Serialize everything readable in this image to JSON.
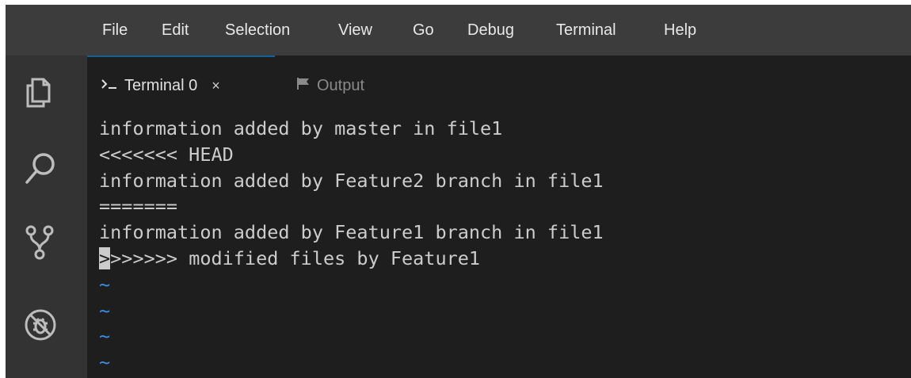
{
  "menu": {
    "items": [
      "File",
      "Edit",
      "Selection",
      "View",
      "Go",
      "Debug",
      "Terminal",
      "Help"
    ]
  },
  "activity_bar": {
    "icons": [
      "explorer-icon",
      "search-icon",
      "source-control-icon",
      "debug-icon"
    ]
  },
  "tabs": {
    "terminal": {
      "label": "Terminal 0",
      "close": "×",
      "icon": "terminal-prompt-icon"
    },
    "output": {
      "label": "Output",
      "icon": "flag-icon"
    }
  },
  "terminal": {
    "lines": [
      "information added by master in file1",
      "<<<<<<< HEAD",
      "information added by Feature2 branch in file1",
      "=======",
      "information added by Feature1 branch in file1"
    ],
    "cursor_line": {
      "cursor_char": ">",
      "rest": ">>>>>> modified files by Feature1"
    },
    "tilde_lines": [
      "~",
      "~",
      "~",
      "~"
    ]
  },
  "colors": {
    "menubar": "#3c3c3c",
    "activity_bar": "#333333",
    "editor_bg": "#1e1e1e",
    "accent": "#0e639c",
    "tilde": "#3b8eea"
  }
}
